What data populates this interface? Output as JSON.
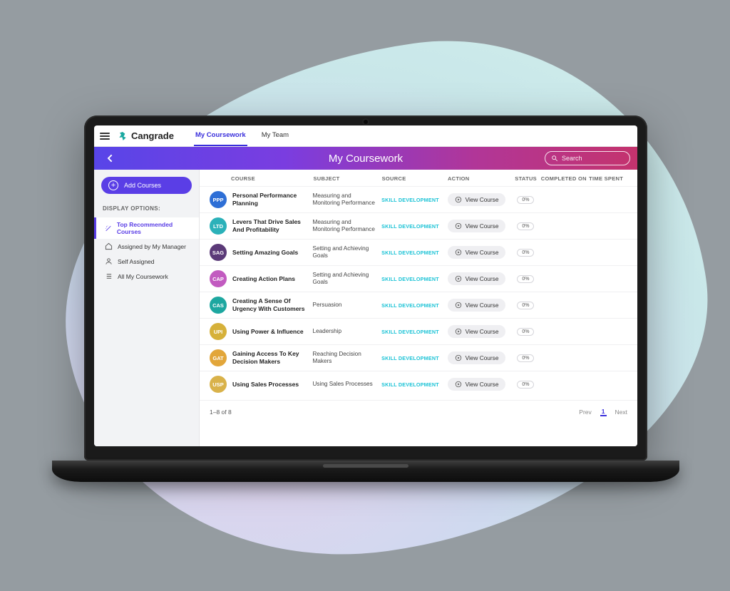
{
  "brand": {
    "name": "Cangrade"
  },
  "topnav": {
    "tabs": [
      {
        "label": "My Coursework",
        "active": true
      },
      {
        "label": "My Team",
        "active": false
      }
    ]
  },
  "header": {
    "title": "My Coursework",
    "search_placeholder": "Search"
  },
  "sidebar": {
    "add_label": "Add Courses",
    "section_label": "DISPLAY OPTIONS:",
    "items": [
      {
        "icon": "wand",
        "label": "Top Recommended Courses",
        "active": true
      },
      {
        "icon": "home",
        "label": "Assigned by My Manager",
        "active": false
      },
      {
        "icon": "user",
        "label": "Self Assigned",
        "active": false
      },
      {
        "icon": "list",
        "label": "All My Coursework",
        "active": false
      }
    ]
  },
  "table": {
    "columns": {
      "course": "COURSE",
      "subject": "SUBJECT",
      "source": "SOURCE",
      "action": "ACTION",
      "status": "STATUS",
      "completed": "COMPLETED ON",
      "time": "TIME SPENT"
    },
    "view_label": "View Course",
    "rows": [
      {
        "abbr": "PPP",
        "color": "#2e6fd6",
        "title": "Personal Performance Planning",
        "subject": "Measuring and Monitoring Performance",
        "source": "SKILL DEVELOPMENT",
        "status": "0%"
      },
      {
        "abbr": "LTD",
        "color": "#2bb1b9",
        "title": "Levers That Drive Sales And Profitability",
        "subject": "Measuring and Monitoring Performance",
        "source": "SKILL DEVELOPMENT",
        "status": "0%"
      },
      {
        "abbr": "SAG",
        "color": "#5b3a78",
        "title": "Setting Amazing Goals",
        "subject": "Setting and Achieving Goals",
        "source": "SKILL DEVELOPMENT",
        "status": "0%"
      },
      {
        "abbr": "CAP",
        "color": "#c25bc0",
        "title": "Creating Action Plans",
        "subject": "Setting and Achieving Goals",
        "source": "SKILL DEVELOPMENT",
        "status": "0%"
      },
      {
        "abbr": "CAS",
        "color": "#1da7a0",
        "title": "Creating A Sense Of Urgency With Customers",
        "subject": "Persuasion",
        "source": "SKILL DEVELOPMENT",
        "status": "0%"
      },
      {
        "abbr": "UPI",
        "color": "#d6b13a",
        "title": "Using Power & Influence",
        "subject": "Leadership",
        "source": "SKILL DEVELOPMENT",
        "status": "0%"
      },
      {
        "abbr": "GAT",
        "color": "#e2a63a",
        "title": "Gaining Access To Key Decision Makers",
        "subject": "Reaching Decision Makers",
        "source": "SKILL DEVELOPMENT",
        "status": "0%"
      },
      {
        "abbr": "USP",
        "color": "#d9b24a",
        "title": "Using Sales Processes",
        "subject": "Using Sales Processes",
        "source": "SKILL DEVELOPMENT",
        "status": "0%"
      }
    ],
    "range_text": "1–8 of 8",
    "prev_label": "Prev",
    "page_num": "1",
    "next_label": "Next"
  }
}
